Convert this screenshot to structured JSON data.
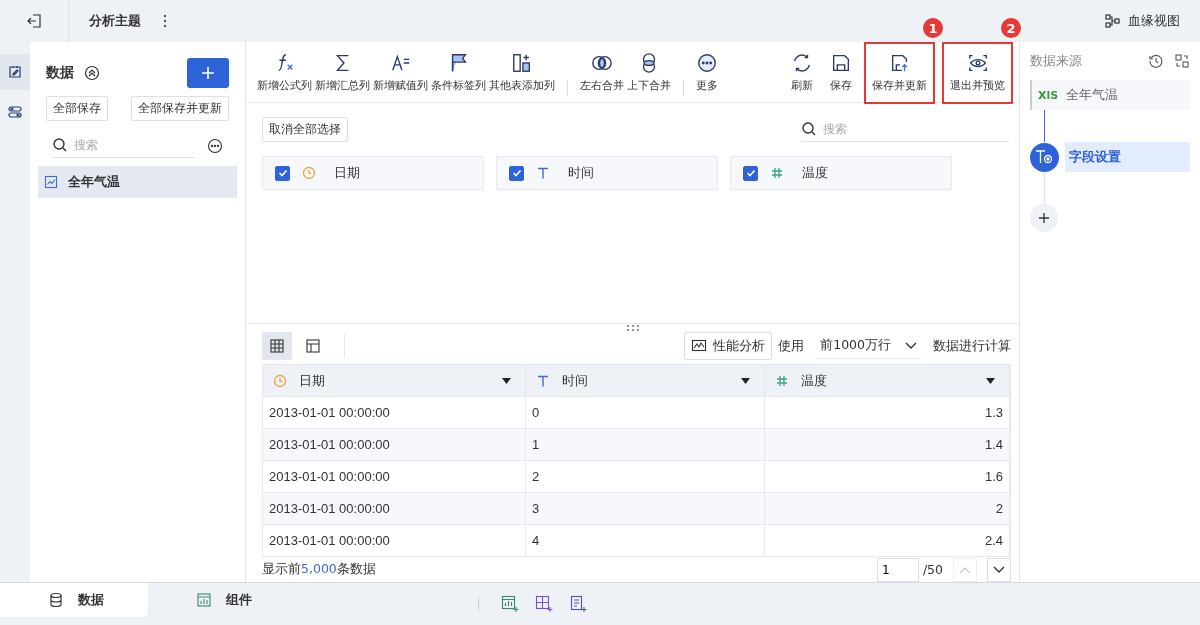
{
  "header": {
    "title": "分析主题",
    "lineage": "血缘视图"
  },
  "rail": [
    {
      "kind": "data",
      "selected": true
    },
    {
      "kind": "flow",
      "selected": false
    }
  ],
  "left_panel": {
    "title": "数据",
    "buttons": [
      "全部保存",
      "全部保存并更新"
    ],
    "search": {
      "placeholder": "搜索"
    },
    "tables": [
      {
        "name": "全年气温",
        "selected": true
      }
    ]
  },
  "toolbar": {
    "items": [
      {
        "kind": "formula",
        "label": "新增公式列"
      },
      {
        "kind": "sum",
        "label": "新增汇总列"
      },
      {
        "kind": "assign",
        "label": "新增赋值列"
      },
      {
        "kind": "flag",
        "label": "条件标签列"
      },
      {
        "kind": "addcol",
        "label": "其他表添加列"
      },
      {
        "kind": "sep"
      },
      {
        "kind": "lr",
        "label": "左右合并"
      },
      {
        "kind": "ud",
        "label": "上下合并"
      },
      {
        "kind": "sep"
      },
      {
        "kind": "more",
        "label": "更多"
      }
    ],
    "right_items": [
      {
        "kind": "refresh",
        "label": "刷新",
        "marker": ""
      },
      {
        "kind": "save",
        "label": "保存",
        "marker": ""
      },
      {
        "kind": "saveupdate",
        "label": "保存并更新",
        "marker": "1"
      },
      {
        "kind": "preview",
        "label": "退出并预览",
        "marker": "2"
      }
    ]
  },
  "fields": {
    "deselect_all": "取消全部选择",
    "search": {
      "placeholder": "搜索"
    },
    "items": [
      {
        "kind": "date",
        "name": "日期",
        "checked": true
      },
      {
        "kind": "text",
        "name": "时间",
        "checked": true
      },
      {
        "kind": "number",
        "name": "温度",
        "checked": true
      }
    ]
  },
  "preview": {
    "views": [
      {
        "kind": "grid",
        "selected": true
      },
      {
        "kind": "layout",
        "selected": false
      }
    ],
    "perf": "性能分析",
    "use": "使用",
    "limit": "前1000万行",
    "compute": "数据进行计算",
    "columns": [
      {
        "kind": "date",
        "name": "日期"
      },
      {
        "kind": "text",
        "name": "时间"
      },
      {
        "kind": "number",
        "name": "温度"
      }
    ],
    "rows": [
      [
        "2013-01-01 00:00:00",
        "0",
        "1.3"
      ],
      [
        "2013-01-01 00:00:00",
        "1",
        "1.4"
      ],
      [
        "2013-01-01 00:00:00",
        "2",
        "1.6"
      ],
      [
        "2013-01-01 00:00:00",
        "3",
        "2"
      ],
      [
        "2013-01-01 00:00:00",
        "4",
        "2.4"
      ]
    ],
    "footer": {
      "prefix": "显示前",
      "count": "5,000",
      "suffix": "条数据"
    },
    "page": "1",
    "total": "/50"
  },
  "flow": {
    "title": "数据来源",
    "source_tag": "XlS",
    "source": "全年气温",
    "steps": [
      {
        "name": "字段设置",
        "selected": true
      }
    ]
  },
  "bottom_tabs": [
    {
      "kind": "data",
      "label": "数据",
      "selected": true
    },
    {
      "kind": "component",
      "label": "组件",
      "selected": false
    }
  ]
}
